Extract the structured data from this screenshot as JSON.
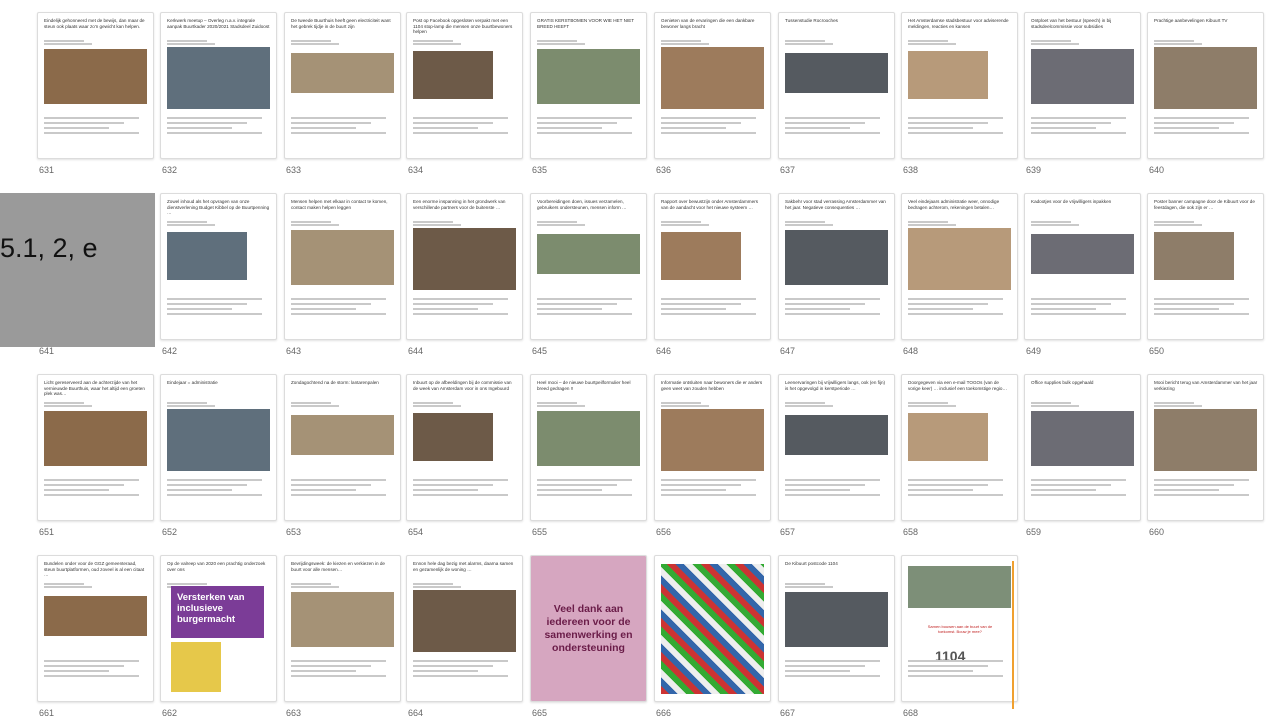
{
  "overlay_text": "5.1, 2, e",
  "pages": [
    {
      "n": "631",
      "title": "Eindelijk gehonneerd met de bewijs, dan maar de steun ook plaats waar zo'n gewicht kan helpen."
    },
    {
      "n": "632",
      "title": "Kerkwerk meetup – Overleg n.a.v. integrale aanpak Buurtkader 2020/2021 Stadsdeel Zuidoost",
      "note": "Dank iedereen die hier weer energie in helpt steken en iedereen tevreden. Nu is het verschillend ook, hee juist omdat verschillend, is een waardevol."
    },
    {
      "n": "633",
      "title": "De tweede Buurthuis heeft geen electriciteit want het gebrek tijdje in de buurt zijn"
    },
    {
      "n": "634",
      "title": "Post op Facebook opgesloten verpakt met een 1104 stop-lamp die mensen onze buurtbewoners helpen"
    },
    {
      "n": "635",
      "title": "GRATIS KERSTBOMEN VOOR WIE HET NIET BREED HEEFT"
    },
    {
      "n": "636",
      "title": "Genieten van de ervaringen die een dankbare bewoner langs bracht"
    },
    {
      "n": "637",
      "title": "Tussenstudie Rocrooches"
    },
    {
      "n": "638",
      "title": "Het Amsterdamse stadsbestuur voor adviserende meldingen, reacties en kansen"
    },
    {
      "n": "639",
      "title": "Ontploet van het bestuur (speech) in bij stadsdeelcommissie voor subsidies"
    },
    {
      "n": "640",
      "title": "Prachtige aanbevelingen Kibuurt TV"
    },
    {
      "n": "641",
      "title": "Betrokken bewoners voor het mitigeren van onze activiteiten per 31 december"
    },
    {
      "n": "642",
      "title": "Zowel inhoud als het opvragen van onze dienstverlening Budget Kibbel op de Buurtpenning …"
    },
    {
      "n": "643",
      "title": "Mensen helpen met elkaar in contact te komen, contact maken helpen leggen"
    },
    {
      "n": "644",
      "title": "Een enorme inspanning in het grondwerk van verschillende partners voor de buitenste …"
    },
    {
      "n": "645",
      "title": "Voorbereidingen doen, issues verzamelen, gebruikers ondersteunen, mensen inform …"
    },
    {
      "n": "646",
      "title": "Rapport over bewustzijn onder Amsterdammers van de aandacht voor het nieuwe systeem …"
    },
    {
      "n": "647",
      "title": "Sakbehr voor stad verrassing Amsterdammer van het jaar. Negatieve consequenties …"
    },
    {
      "n": "648",
      "title": "Veel eindejaars administratie weer, onnodige bedragen achterom, rekeningen betalen…"
    },
    {
      "n": "649",
      "title": "Kadootjes voor de vrijwilligers inpakken"
    },
    {
      "n": "650",
      "title": "Poster banner campagne door de Kibuurt voor de feestdagen, die ook zijn er …"
    },
    {
      "n": "651",
      "title": "Licht gereserveerd aan de achterzijde van het vernieuwde Buurthuis, waar het altijd een groeten plek was…"
    },
    {
      "n": "652",
      "title": "Eindejaar = administratie"
    },
    {
      "n": "653",
      "title": "Zondagochtend na de storm: lantarenpalen"
    },
    {
      "n": "654",
      "title": "Inbuurt op de afbeeldingen bij de commissie van de week van Amsterdam voor in ons Ingebuurd"
    },
    {
      "n": "655",
      "title": "Heel mooi – de nieuwe buurtpeilformulier heel breed gedragen !!"
    },
    {
      "n": "656",
      "title": "Informatie ontsluiten naar bewoners die er anders geen weet van zouden hebben"
    },
    {
      "n": "657",
      "title": "Leenervaringen bij vrijwilligers langs, ook (en fijn) is het opgevolgd in kerstperiode …"
    },
    {
      "n": "658",
      "title": "Doorgegeven via een e-mail TOGOs (van de vorige keer) … inclusief een toekomstige regio…"
    },
    {
      "n": "659",
      "title": "Office supplies bulk opgehaald"
    },
    {
      "n": "660",
      "title": "Mooi bericht terug van Amsterdammer van het jaar verkiezing"
    },
    {
      "n": "661",
      "title": "Bundelen onder voor de GGZ gemeenteraad, steun buurtplatformen, oud zoveel is al een citaat …"
    },
    {
      "n": "662",
      "title": "Op de valreep van 2020 een prachtig onderzoek over ons"
    },
    {
      "n": "663",
      "title": "Bevrijdingsweek: de kiezen en verkiezen in de buurt voor alle mensen…"
    },
    {
      "n": "664",
      "title": "Ennon hele dag bezig met alarms, daarna samen en gezamenlijk de woning …"
    },
    {
      "n": "665",
      "title": ""
    },
    {
      "n": "666",
      "title": ""
    },
    {
      "n": "667",
      "title": "De Kibuurt postcode 1104"
    },
    {
      "n": "668",
      "title": ""
    }
  ],
  "thanks_text": "Veel dank aan iedereen voor de samenwerking en ondersteuning",
  "burger_text": "Versterken van inclusieve burgermacht",
  "badge_1104": "1104",
  "red_caption": "Samen bouwen aan de buurt van de toekomst. Bouw je mee?"
}
